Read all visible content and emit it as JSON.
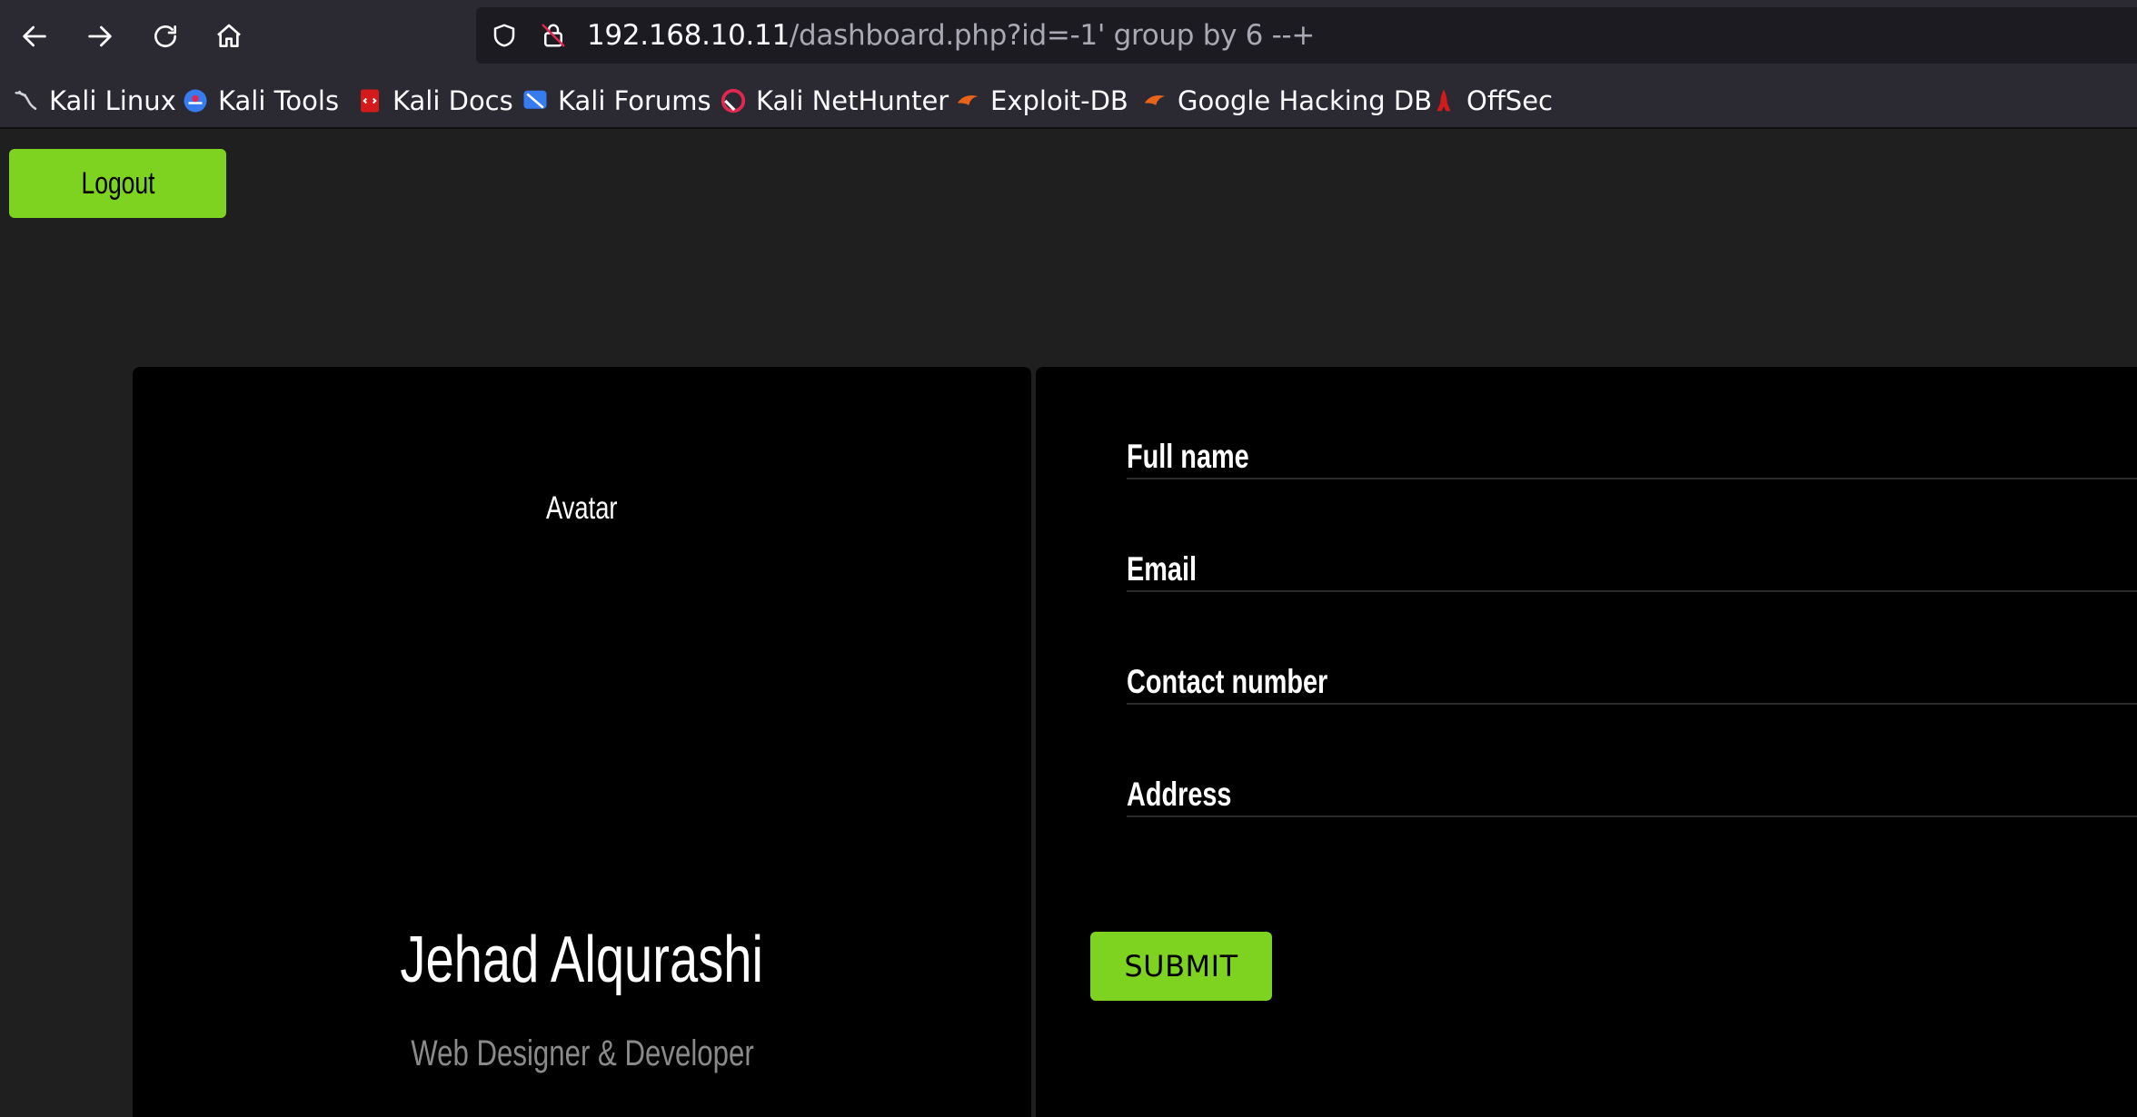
{
  "browser": {
    "url_host": "192.168.10.11",
    "url_path": "/dashboard.php?id=-1' group by 6 --+",
    "nav": {
      "back_icon": "arrow-left-icon",
      "forward_icon": "arrow-right-icon",
      "reload_icon": "reload-icon",
      "home_icon": "home-icon"
    }
  },
  "bookmarks": [
    {
      "label": "Kali Linux",
      "icon": "kali-dragon-icon"
    },
    {
      "label": "Kali Tools",
      "icon": "kali-tools-icon"
    },
    {
      "label": "Kali Docs",
      "icon": "kali-docs-icon"
    },
    {
      "label": "Kali Forums",
      "icon": "kali-forums-icon"
    },
    {
      "label": "Kali NetHunter",
      "icon": "nethunter-icon"
    },
    {
      "label": "Exploit-DB",
      "icon": "exploit-db-icon"
    },
    {
      "label": "Google Hacking DB",
      "icon": "ghdb-icon"
    },
    {
      "label": "OffSec",
      "icon": "offsec-icon"
    }
  ],
  "page": {
    "logout_label": "Logout",
    "profile": {
      "avatar_alt": "Avatar",
      "name": "Jehad Alqurashi",
      "role": "Web Designer & Developer"
    },
    "form": {
      "fields": [
        "Full name",
        "Email",
        "Contact number",
        "Address"
      ],
      "submit_label": "SUBMIT"
    }
  },
  "colors": {
    "accent": "#7ed321",
    "page_bg": "#1f1f1f",
    "card_bg": "#000000",
    "toolbar_bg": "#2b2a33"
  }
}
